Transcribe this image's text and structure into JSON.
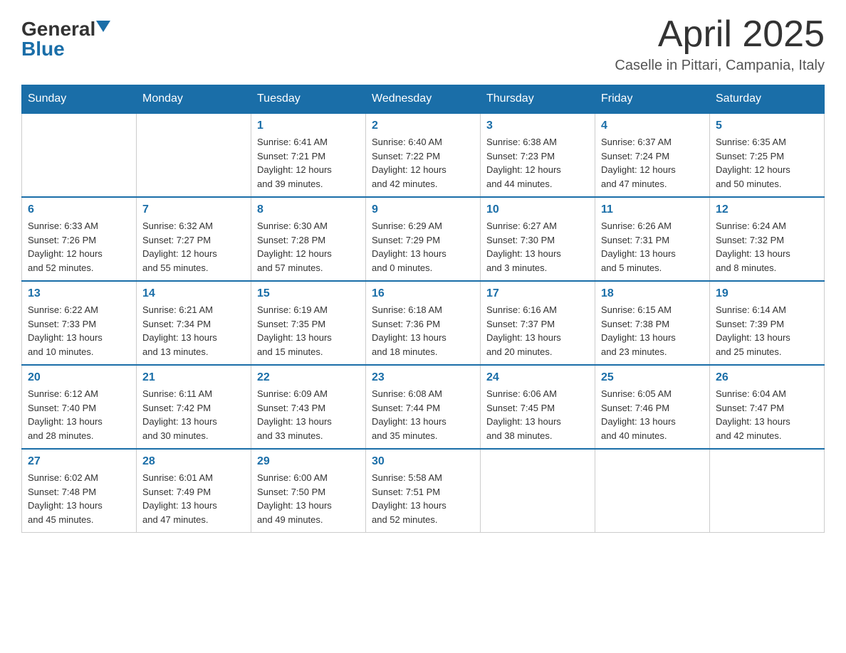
{
  "header": {
    "logo_general": "General",
    "logo_blue": "Blue",
    "month_title": "April 2025",
    "location": "Caselle in Pittari, Campania, Italy"
  },
  "weekdays": [
    "Sunday",
    "Monday",
    "Tuesday",
    "Wednesday",
    "Thursday",
    "Friday",
    "Saturday"
  ],
  "weeks": [
    [
      {
        "day": "",
        "info": ""
      },
      {
        "day": "",
        "info": ""
      },
      {
        "day": "1",
        "info": "Sunrise: 6:41 AM\nSunset: 7:21 PM\nDaylight: 12 hours\nand 39 minutes."
      },
      {
        "day": "2",
        "info": "Sunrise: 6:40 AM\nSunset: 7:22 PM\nDaylight: 12 hours\nand 42 minutes."
      },
      {
        "day": "3",
        "info": "Sunrise: 6:38 AM\nSunset: 7:23 PM\nDaylight: 12 hours\nand 44 minutes."
      },
      {
        "day": "4",
        "info": "Sunrise: 6:37 AM\nSunset: 7:24 PM\nDaylight: 12 hours\nand 47 minutes."
      },
      {
        "day": "5",
        "info": "Sunrise: 6:35 AM\nSunset: 7:25 PM\nDaylight: 12 hours\nand 50 minutes."
      }
    ],
    [
      {
        "day": "6",
        "info": "Sunrise: 6:33 AM\nSunset: 7:26 PM\nDaylight: 12 hours\nand 52 minutes."
      },
      {
        "day": "7",
        "info": "Sunrise: 6:32 AM\nSunset: 7:27 PM\nDaylight: 12 hours\nand 55 minutes."
      },
      {
        "day": "8",
        "info": "Sunrise: 6:30 AM\nSunset: 7:28 PM\nDaylight: 12 hours\nand 57 minutes."
      },
      {
        "day": "9",
        "info": "Sunrise: 6:29 AM\nSunset: 7:29 PM\nDaylight: 13 hours\nand 0 minutes."
      },
      {
        "day": "10",
        "info": "Sunrise: 6:27 AM\nSunset: 7:30 PM\nDaylight: 13 hours\nand 3 minutes."
      },
      {
        "day": "11",
        "info": "Sunrise: 6:26 AM\nSunset: 7:31 PM\nDaylight: 13 hours\nand 5 minutes."
      },
      {
        "day": "12",
        "info": "Sunrise: 6:24 AM\nSunset: 7:32 PM\nDaylight: 13 hours\nand 8 minutes."
      }
    ],
    [
      {
        "day": "13",
        "info": "Sunrise: 6:22 AM\nSunset: 7:33 PM\nDaylight: 13 hours\nand 10 minutes."
      },
      {
        "day": "14",
        "info": "Sunrise: 6:21 AM\nSunset: 7:34 PM\nDaylight: 13 hours\nand 13 minutes."
      },
      {
        "day": "15",
        "info": "Sunrise: 6:19 AM\nSunset: 7:35 PM\nDaylight: 13 hours\nand 15 minutes."
      },
      {
        "day": "16",
        "info": "Sunrise: 6:18 AM\nSunset: 7:36 PM\nDaylight: 13 hours\nand 18 minutes."
      },
      {
        "day": "17",
        "info": "Sunrise: 6:16 AM\nSunset: 7:37 PM\nDaylight: 13 hours\nand 20 minutes."
      },
      {
        "day": "18",
        "info": "Sunrise: 6:15 AM\nSunset: 7:38 PM\nDaylight: 13 hours\nand 23 minutes."
      },
      {
        "day": "19",
        "info": "Sunrise: 6:14 AM\nSunset: 7:39 PM\nDaylight: 13 hours\nand 25 minutes."
      }
    ],
    [
      {
        "day": "20",
        "info": "Sunrise: 6:12 AM\nSunset: 7:40 PM\nDaylight: 13 hours\nand 28 minutes."
      },
      {
        "day": "21",
        "info": "Sunrise: 6:11 AM\nSunset: 7:42 PM\nDaylight: 13 hours\nand 30 minutes."
      },
      {
        "day": "22",
        "info": "Sunrise: 6:09 AM\nSunset: 7:43 PM\nDaylight: 13 hours\nand 33 minutes."
      },
      {
        "day": "23",
        "info": "Sunrise: 6:08 AM\nSunset: 7:44 PM\nDaylight: 13 hours\nand 35 minutes."
      },
      {
        "day": "24",
        "info": "Sunrise: 6:06 AM\nSunset: 7:45 PM\nDaylight: 13 hours\nand 38 minutes."
      },
      {
        "day": "25",
        "info": "Sunrise: 6:05 AM\nSunset: 7:46 PM\nDaylight: 13 hours\nand 40 minutes."
      },
      {
        "day": "26",
        "info": "Sunrise: 6:04 AM\nSunset: 7:47 PM\nDaylight: 13 hours\nand 42 minutes."
      }
    ],
    [
      {
        "day": "27",
        "info": "Sunrise: 6:02 AM\nSunset: 7:48 PM\nDaylight: 13 hours\nand 45 minutes."
      },
      {
        "day": "28",
        "info": "Sunrise: 6:01 AM\nSunset: 7:49 PM\nDaylight: 13 hours\nand 47 minutes."
      },
      {
        "day": "29",
        "info": "Sunrise: 6:00 AM\nSunset: 7:50 PM\nDaylight: 13 hours\nand 49 minutes."
      },
      {
        "day": "30",
        "info": "Sunrise: 5:58 AM\nSunset: 7:51 PM\nDaylight: 13 hours\nand 52 minutes."
      },
      {
        "day": "",
        "info": ""
      },
      {
        "day": "",
        "info": ""
      },
      {
        "day": "",
        "info": ""
      }
    ]
  ]
}
